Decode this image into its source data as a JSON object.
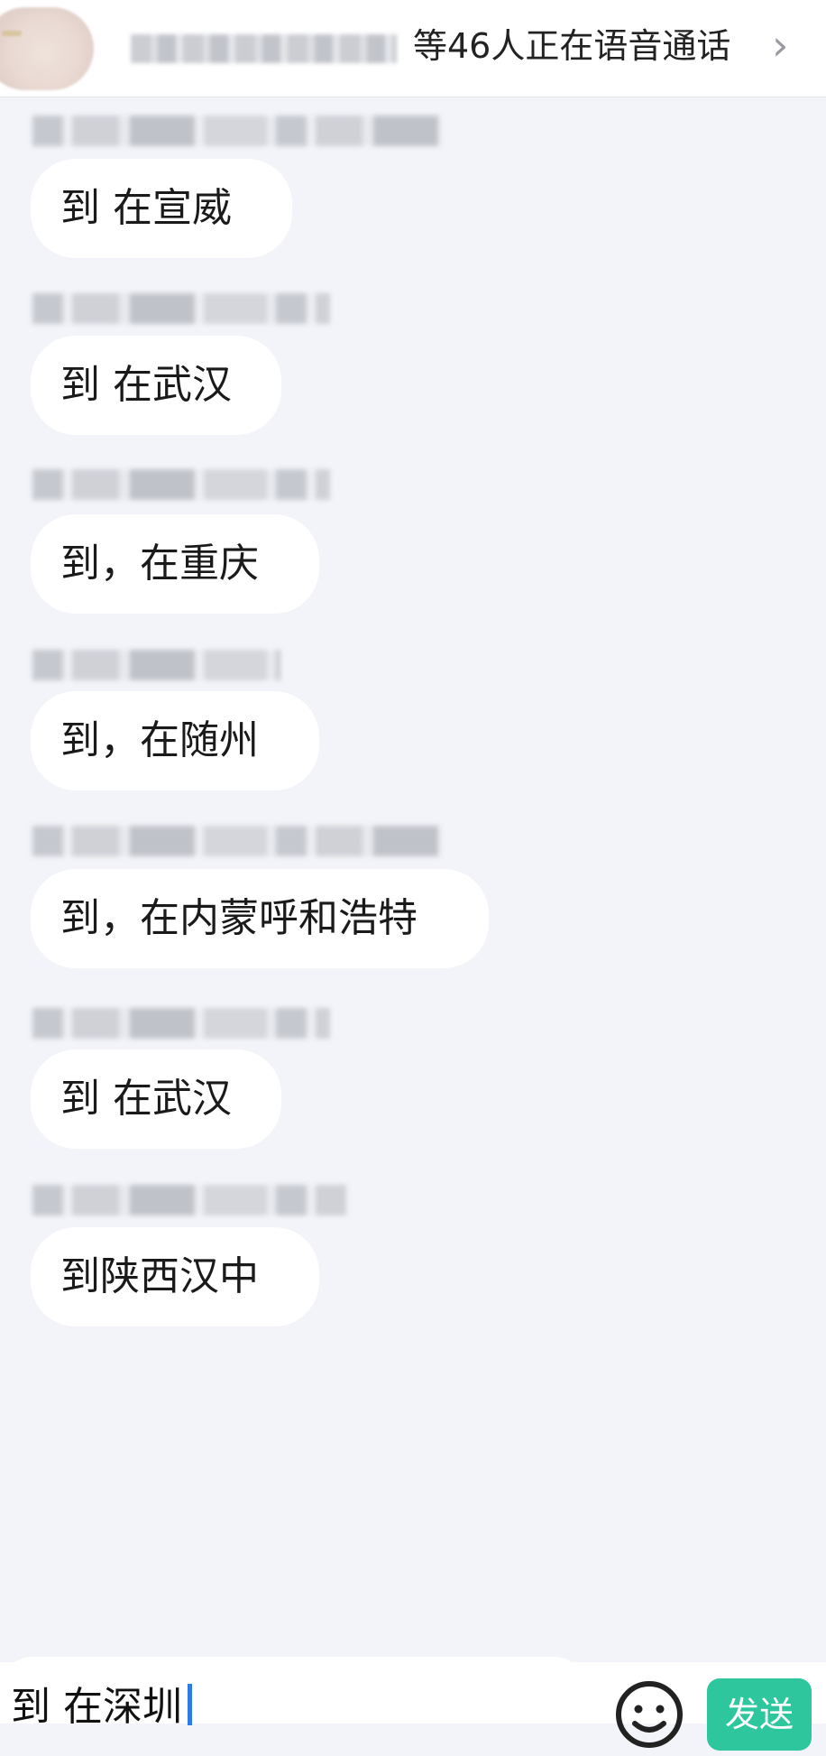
{
  "header": {
    "voice_call_status": "等46人正在语音通话",
    "chevron": "›"
  },
  "messages": [
    {
      "text": "到  在宣威"
    },
    {
      "text": "到 在武汉"
    },
    {
      "text": "到，在重庆"
    },
    {
      "text": "到，在随州"
    },
    {
      "text": "到，在内蒙呼和浩特"
    },
    {
      "text": "到 在武汉"
    },
    {
      "text": "到陕西汉中"
    }
  ],
  "composer": {
    "input_value": "到 在深圳",
    "send_label": "发送",
    "emoji_icon": "smiley-face-icon"
  },
  "colors": {
    "background": "#f3f4f9",
    "bubble": "#ffffff",
    "send_button": "#2ec79d",
    "caret": "#2e7be8"
  }
}
